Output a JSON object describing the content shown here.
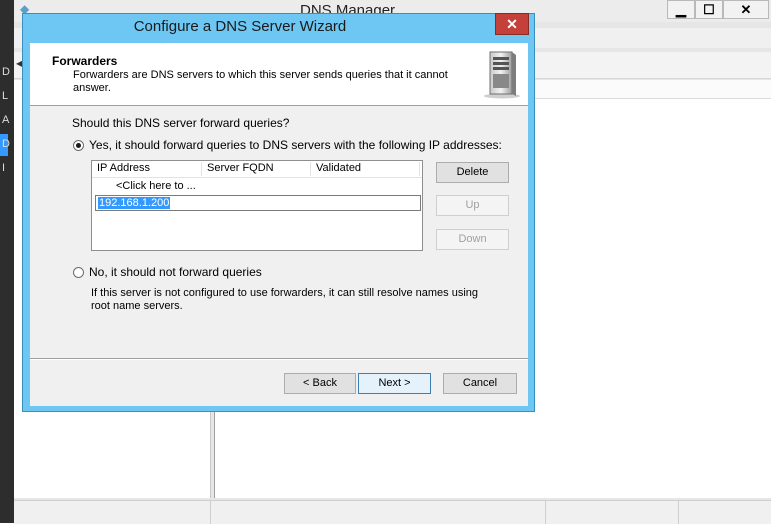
{
  "background": {
    "title": "DNS Manager",
    "controls": {
      "minimize": "▁",
      "maximize": "☐",
      "close": "✕"
    },
    "left_letters": [
      "D",
      "L",
      "A",
      "D",
      "I"
    ]
  },
  "wizard": {
    "title": "Configure a DNS Server Wizard",
    "close_label": "✕",
    "header": {
      "title": "Forwarders",
      "description": "Forwarders are DNS servers to which this server sends queries that it cannot answer.",
      "icon": "server-icon"
    },
    "question": "Should this DNS server forward queries?",
    "option_yes": {
      "label": "Yes, it should forward queries to DNS servers with the following IP addresses:",
      "checked": true
    },
    "table": {
      "columns": [
        "IP Address",
        "Server FQDN",
        "Validated"
      ],
      "placeholder_row": "<Click here to ...",
      "edit_value": "192.168.1.200"
    },
    "side_buttons": {
      "delete": "Delete",
      "up": "Up",
      "down": "Down"
    },
    "option_no": {
      "label": "No, it should not forward queries",
      "checked": false,
      "description": "If this server is not configured to use forwarders, it can still resolve names using root name servers."
    },
    "nav_buttons": {
      "back": "< Back",
      "next": "Next >",
      "cancel": "Cancel"
    }
  }
}
